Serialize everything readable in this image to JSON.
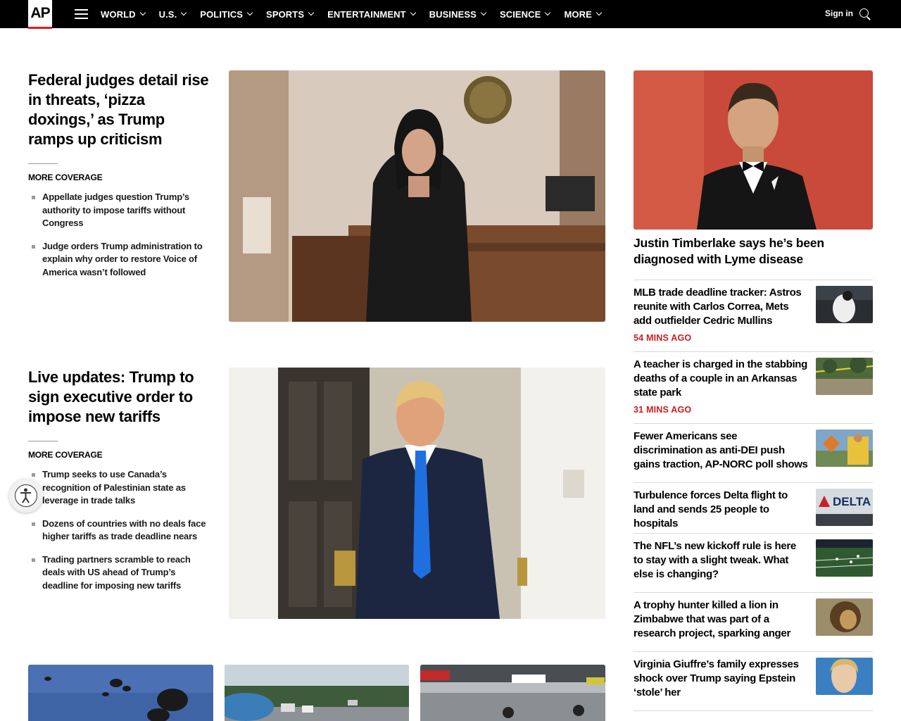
{
  "brand": {
    "logo_text": "AP",
    "accent": "#e01a22"
  },
  "nav": {
    "items": [
      "WORLD",
      "U.S.",
      "POLITICS",
      "SPORTS",
      "ENTERTAINMENT",
      "BUSINESS",
      "SCIENCE",
      "MORE"
    ],
    "signin": "Sign in",
    "icons": [
      "menu-icon",
      "search-icon"
    ]
  },
  "leads": [
    {
      "title": "Federal judges detail rise in threats, ‘pizza doxings,’ as Trump ramps up criticism",
      "more_coverage_label": "MORE COVERAGE",
      "coverage": [
        "Appellate judges question Trump’s authority to impose tariffs without Congress",
        "Judge orders Trump administration to explain why order to restore Voice of America wasn’t followed"
      ]
    },
    {
      "title": "Live updates: Trump to sign executive order to impose new tariffs",
      "more_coverage_label": "MORE COVERAGE",
      "coverage": [
        "Trump seeks to use Canada’s recognition of Palestinian state as leverage in trade talks",
        "Dozens of countries with no deals face higher tariffs as trade deadline nears",
        "Trading partners scramble to reach deals with US ahead of Trump’s deadline for imposing new tariffs"
      ]
    }
  ],
  "right_column": {
    "hero_title": "Justin Timberlake says he’s been diagnosed with Lyme disease",
    "items": [
      {
        "title": "MLB trade deadline tracker: Astros reunite with Carlos Correa, Mets add outfielder Cedric Mullins",
        "timestamp": "54 MINS AGO"
      },
      {
        "title": "A teacher is charged in the stabbing deaths of a couple in an Arkansas state park",
        "timestamp": "31 MINS AGO"
      },
      {
        "title": "Fewer Americans see discrimination as anti-DEI push gains traction, AP-NORC poll shows",
        "timestamp": ""
      },
      {
        "title": "Turbulence forces Delta flight to land and sends 25 people to hospitals",
        "timestamp": ""
      },
      {
        "title": "The NFL’s new kickoff rule is here to stay with a slight tweak. What else is changing?",
        "timestamp": ""
      },
      {
        "title": "A trophy hunter killed a lion in Zimbabwe that was part of a research project, sparking anger",
        "timestamp": ""
      },
      {
        "title": "Virginia Giuffre’s family expresses shock over Trump saying Epstein ‘stole’ her",
        "timestamp": ""
      }
    ],
    "delta_thumb_text": "DELTA"
  },
  "colors": {
    "timestamp": "#c81e1e",
    "nav_bg": "#000000"
  }
}
